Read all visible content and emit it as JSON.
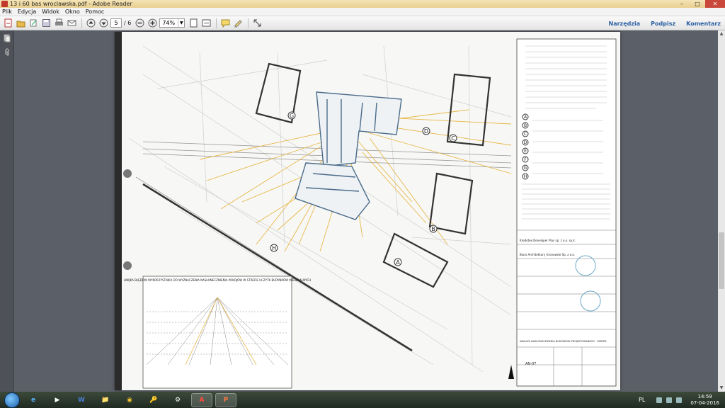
{
  "window": {
    "title": "13 i 60 bas wroclawska.pdf - Adobe Reader",
    "minimize": "–",
    "maximize": "□",
    "close": "✕"
  },
  "menu": [
    "Plik",
    "Edycja",
    "Widok",
    "Okno",
    "Pomoc"
  ],
  "toolbar": {
    "page_current": "5",
    "page_total": "/ 6",
    "zoom": "74%",
    "right_links": [
      "Narzędzia",
      "Podpisz",
      "Komentarz"
    ]
  },
  "document": {
    "legend_labels": [
      "A",
      "B",
      "C",
      "D",
      "E",
      "F",
      "G",
      "H"
    ],
    "plan_labels": {
      "label_g": "G",
      "label_d": "D",
      "label_c": "C",
      "label_b": "B",
      "label_a": "A",
      "label_h": "H"
    },
    "chart_title": "LINIJKA BŁĘDÓW WYKORZYSTANIA DO WYZNACZENIA NASŁONECZNIENIA POKOJÓW W STREFIE UCZYTK BUDYNKÓW MIESZKALNYCH",
    "title_block": {
      "investor": "Kredotex Developer Plus sp. z o.o. sp.k.",
      "office": "Biuro Architektury Gronowski Sp. z o.o.",
      "drawing_title": "ANALIZA NASŁONECZNIENIA BUDYNKÓW PROJEKTOWANEGO - PARTER",
      "sheet": "AN-07"
    },
    "colors": {
      "sun_lines": "#e8b84a",
      "building": "#3a3a3a",
      "project_building": "#4a6b8a"
    }
  },
  "taskbar": {
    "apps": [
      "e",
      "▶",
      "W",
      "📁",
      "◉",
      "🔑",
      "⚙",
      "A",
      "P"
    ],
    "language": "PL",
    "time": "14:59",
    "date": "07-04-2016"
  }
}
